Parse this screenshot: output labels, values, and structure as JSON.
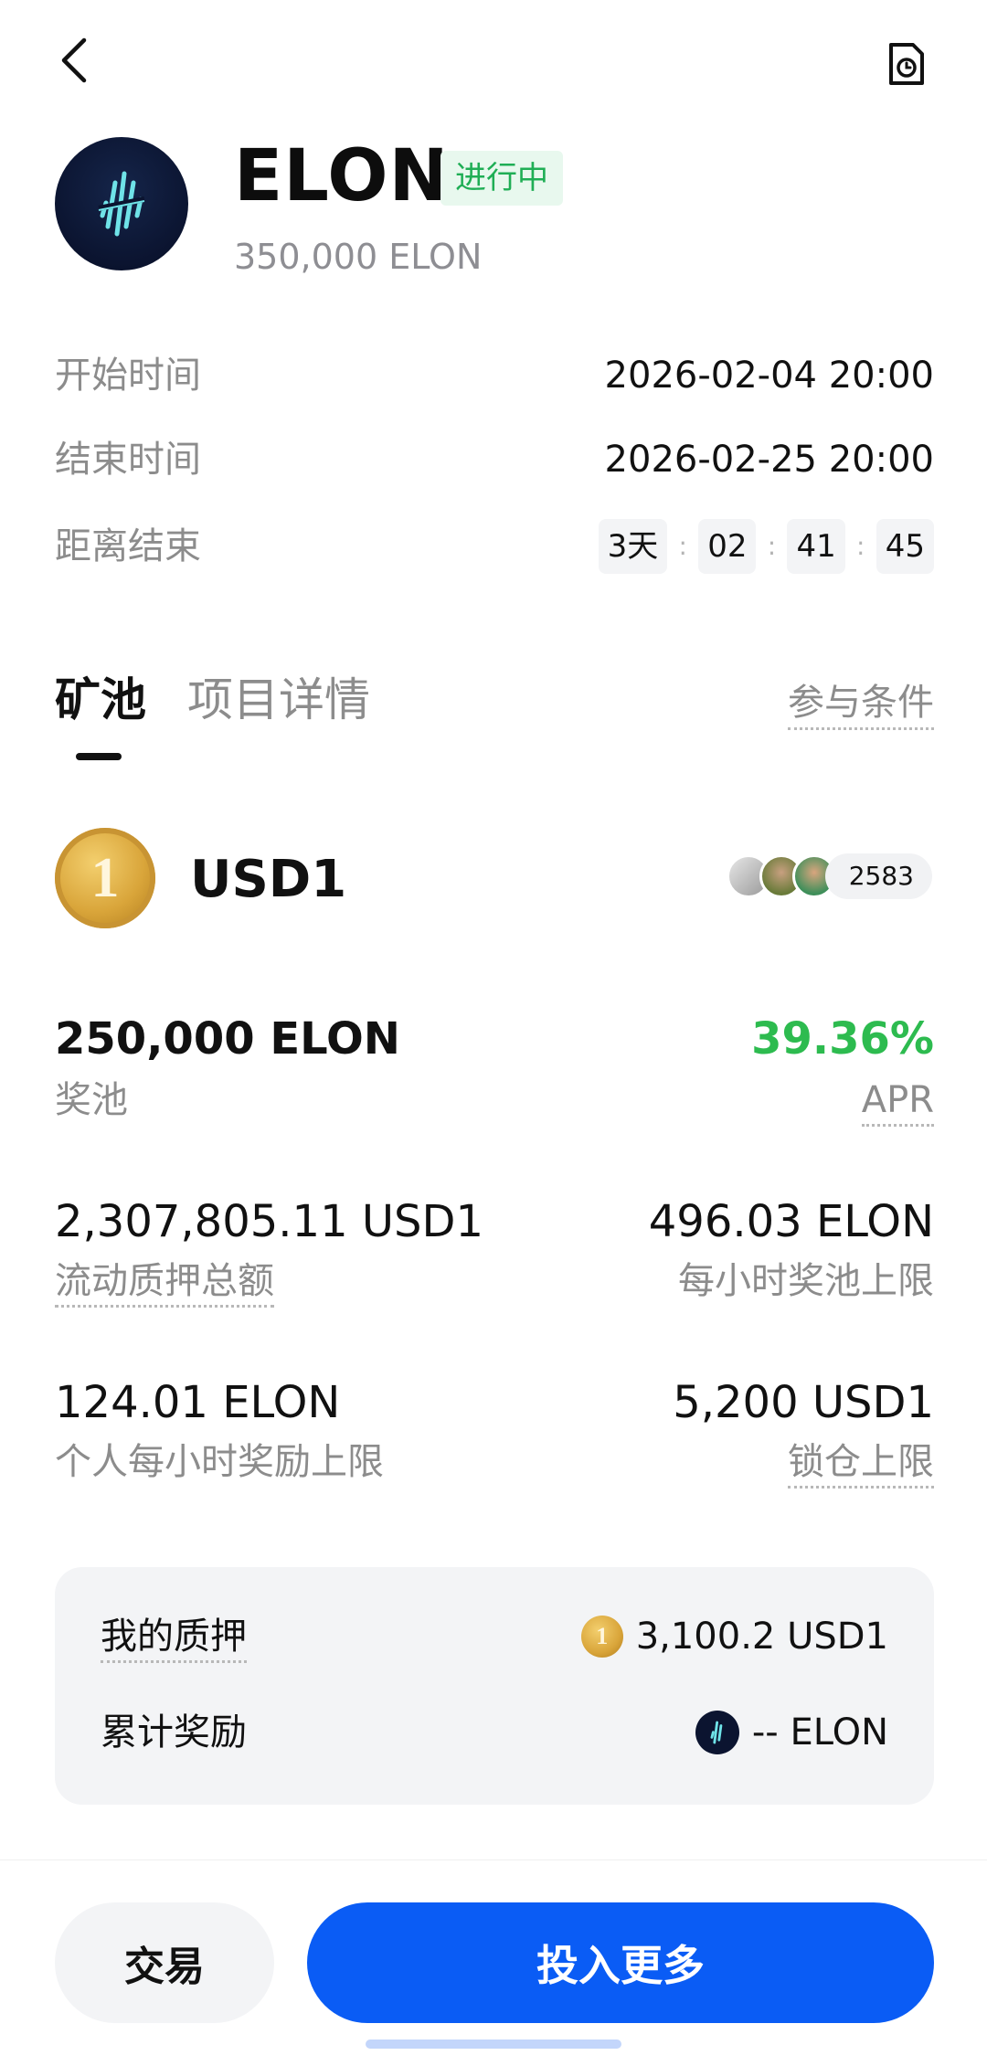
{
  "header": {
    "token_name": "ELON",
    "status": "进行中",
    "total_amount": "350,000 ELON"
  },
  "schedule": {
    "start_label": "开始时间",
    "start_value": "2026-02-04 20:00",
    "end_label": "结束时间",
    "end_value": "2026-02-25 20:00",
    "remaining_label": "距离结束",
    "countdown": {
      "days": "3天",
      "hours": "02",
      "minutes": "41",
      "seconds": "45",
      "separator": ":"
    }
  },
  "tabs": [
    {
      "label": "矿池",
      "active": true
    },
    {
      "label": "项目详情",
      "active": false
    }
  ],
  "conditions_link": "参与条件",
  "pool": {
    "coin_icon_digit": "1",
    "name": "USD1",
    "participant_count": "2583",
    "prize_pool_value": "250,000 ELON",
    "prize_pool_label": "奖池",
    "apr_value": "39.36%",
    "apr_label": "APR",
    "total_staked_value": "2,307,805.11 USD1",
    "total_staked_label": "流动质押总额",
    "hourly_cap_value": "496.03 ELON",
    "hourly_cap_label": "每小时奖池上限",
    "personal_cap_value": "124.01 ELON",
    "personal_cap_label": "个人每小时奖励上限",
    "lock_cap_value": "5,200 USD1",
    "lock_cap_label": "锁仓上限"
  },
  "my_stake": {
    "stake_label": "我的质押",
    "stake_value": "3,100.2 USD1",
    "reward_label": "累计奖励",
    "reward_value": "-- ELON"
  },
  "actions": {
    "trade": "交易",
    "invest_more": "投入更多"
  },
  "colors": {
    "accent_blue": "#0a5cf5",
    "apr_green": "#2dbb4f",
    "status_green": "#1fae55",
    "status_bg": "#e8f8ee"
  }
}
